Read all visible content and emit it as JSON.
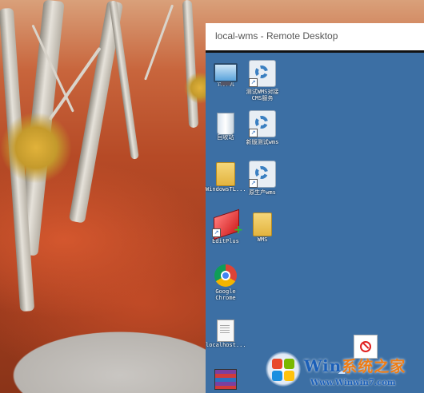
{
  "window": {
    "title": "local-wms - Remote Desktop"
  },
  "desktop_icons": [
    {
      "label": "计算机",
      "icon": "computer-icon"
    },
    {
      "label": "测试WMS对接\nCMS服务",
      "icon": "gear-app-icon"
    },
    {
      "label": "回收站",
      "icon": "recycle-bin-icon"
    },
    {
      "label": "新版测试wms",
      "icon": "gear-app-icon"
    },
    {
      "label": "WindowsTL...",
      "icon": "folder-icon"
    },
    {
      "label": "原生产wms",
      "icon": "gear-app-icon"
    },
    {
      "label": "EditPlus",
      "icon": "editplus-icon"
    },
    {
      "label": "WMS",
      "icon": "folder-icon"
    },
    {
      "label": "Google\nChrome",
      "icon": "chrome-icon"
    },
    {
      "label": "localhost...",
      "icon": "document-icon"
    },
    {
      "label": "",
      "icon": "winrar-icon"
    }
  ],
  "watermark": {
    "brand_latin": "Win",
    "brand_cn": "系统之家",
    "url": "Www.Winwin7.com",
    "colors": {
      "blue": "#1b5fb8",
      "orange": "#ef7c14"
    }
  },
  "colors": {
    "remote_desktop_bg": "#3c6fa4",
    "blocked_icon": "#e02020"
  }
}
